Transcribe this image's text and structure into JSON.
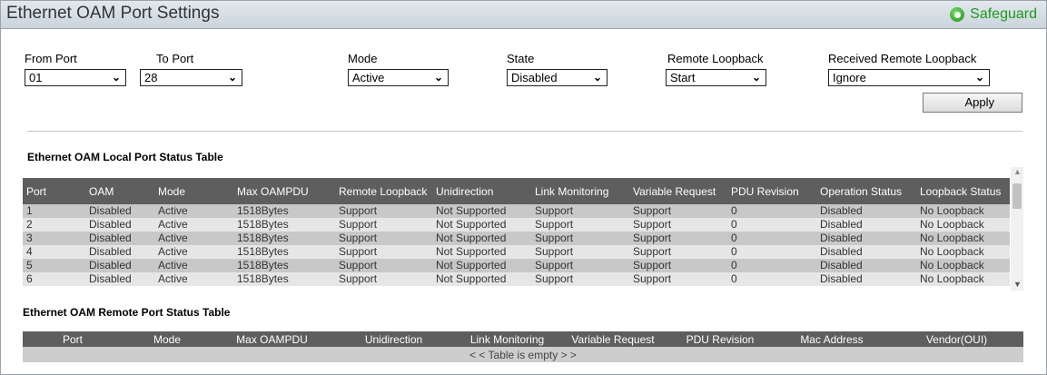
{
  "page": {
    "title": "Ethernet OAM Port Settings",
    "safeguard_label": "Safeguard"
  },
  "form": {
    "from_port": {
      "label": "From Port",
      "value": "01"
    },
    "to_port": {
      "label": "To Port",
      "value": "28"
    },
    "mode": {
      "label": "Mode",
      "value": "Active"
    },
    "state": {
      "label": "State",
      "value": "Disabled"
    },
    "remote_loopback": {
      "label": "Remote Loopback",
      "value": "Start"
    },
    "received_remote_loopback": {
      "label": "Received Remote Loopback",
      "value": "Ignore"
    },
    "apply_label": "Apply"
  },
  "local_table": {
    "title": "Ethernet OAM Local Port Status Table",
    "headers": [
      "Port",
      "OAM",
      "Mode",
      "Max OAMPDU",
      "Remote Loopback",
      "Unidirection",
      "Link Monitoring",
      "Variable Request",
      "PDU Revision",
      "Operation Status",
      "Loopback Status"
    ],
    "rows": [
      [
        "1",
        "Disabled",
        "Active",
        "1518Bytes",
        "Support",
        "Not Supported",
        "Support",
        "Support",
        "0",
        "Disabled",
        "No Loopback"
      ],
      [
        "2",
        "Disabled",
        "Active",
        "1518Bytes",
        "Support",
        "Not Supported",
        "Support",
        "Support",
        "0",
        "Disabled",
        "No Loopback"
      ],
      [
        "3",
        "Disabled",
        "Active",
        "1518Bytes",
        "Support",
        "Not Supported",
        "Support",
        "Support",
        "0",
        "Disabled",
        "No Loopback"
      ],
      [
        "4",
        "Disabled",
        "Active",
        "1518Bytes",
        "Support",
        "Not Supported",
        "Support",
        "Support",
        "0",
        "Disabled",
        "No Loopback"
      ],
      [
        "5",
        "Disabled",
        "Active",
        "1518Bytes",
        "Support",
        "Not Supported",
        "Support",
        "Support",
        "0",
        "Disabled",
        "No Loopback"
      ],
      [
        "6",
        "Disabled",
        "Active",
        "1518Bytes",
        "Support",
        "Not Supported",
        "Support",
        "Support",
        "0",
        "Disabled",
        "No Loopback"
      ]
    ]
  },
  "remote_table": {
    "title": "Ethernet OAM Remote Port Status Table",
    "headers": [
      "Port",
      "Mode",
      "Max OAMPDU",
      "Unidirection",
      "Link Monitoring",
      "Variable Request",
      "PDU Revision",
      "Mac Address",
      "Vendor(OUI)"
    ],
    "empty_text": "< < Table is empty > >"
  },
  "colors": {
    "header_bg": "#5e5e5e",
    "row_odd": "#c8c8c8",
    "row_even": "#e6e6e6",
    "safeguard_green": "#1c9a1c"
  }
}
